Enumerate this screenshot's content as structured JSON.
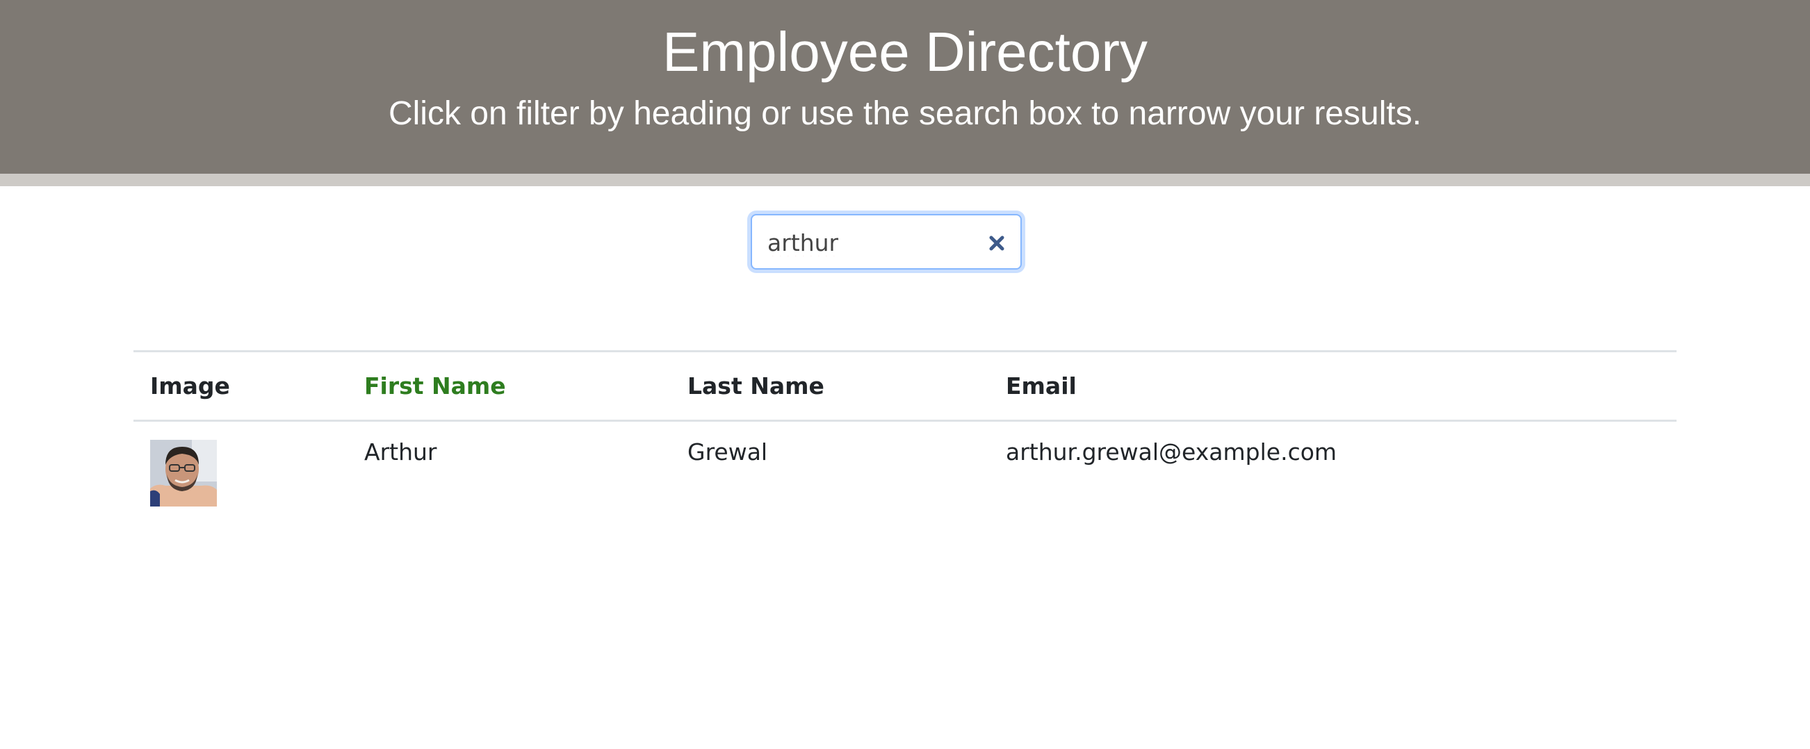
{
  "header": {
    "title": "Employee Directory",
    "subtitle": "Click on filter by heading or use the search box to narrow your results.",
    "background_color": "#7e7973"
  },
  "search": {
    "value": "arthur",
    "clear_icon": "close-icon"
  },
  "table": {
    "columns": [
      "Image",
      "First Name",
      "Last Name",
      "Email"
    ],
    "active_column": "First Name",
    "active_column_color": "#2e7d1f",
    "rows": [
      {
        "image": "employee-photo",
        "first_name": "Arthur",
        "last_name": "Grewal",
        "email": "arthur.grewal@example.com"
      }
    ]
  }
}
